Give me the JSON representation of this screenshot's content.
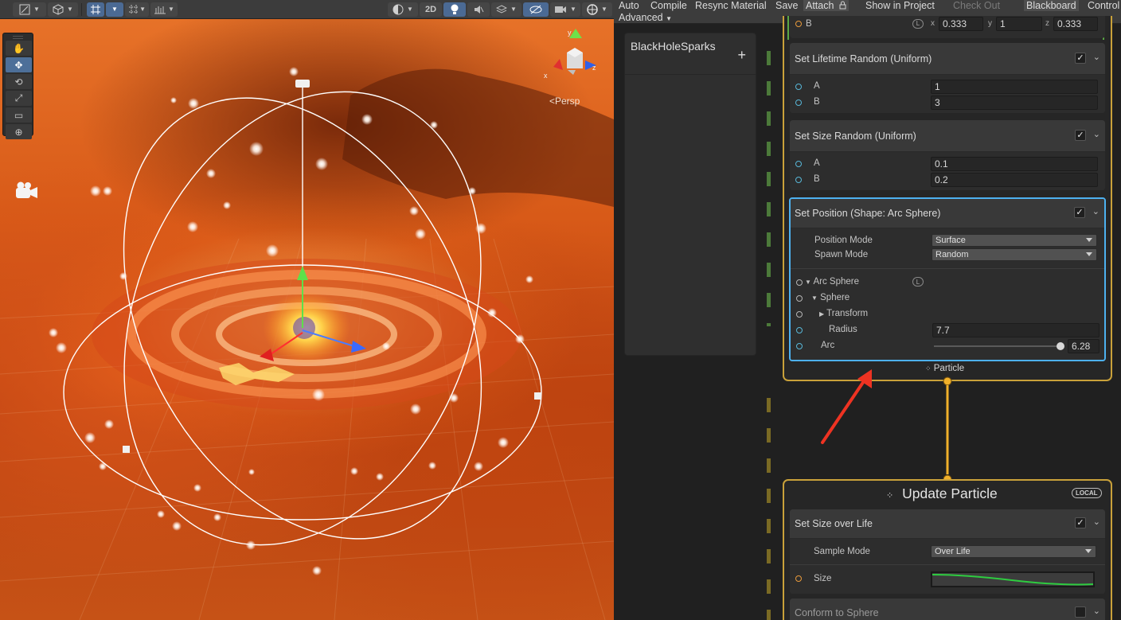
{
  "scene": {
    "toolbar": {
      "left_tools": [
        "draw-mode",
        "shading",
        "grid",
        "snap",
        "increment"
      ],
      "right_tools": [
        "render-mode",
        "2D",
        "lighting",
        "audio",
        "effects",
        "hidden",
        "camera",
        "gizmos"
      ],
      "two_d_label": "2D"
    },
    "tools": [
      "✋",
      "✥",
      "⟲",
      "⤢",
      "▭",
      "⊕"
    ],
    "gizmo": {
      "y_label": "y",
      "x_label": "x",
      "z_label": "z"
    },
    "persp_label": "<Persp"
  },
  "menubar": {
    "auto": "Auto",
    "compile": "Compile",
    "resync": "Resync Material",
    "save": "Save",
    "attach": "Attach",
    "show_in_project": "Show in Project",
    "check_out": "Check Out",
    "blackboard": "Blackboard",
    "control": "Control",
    "advanced": "Advanced"
  },
  "blackboard": {
    "title": "BlackHoleSparks",
    "add_symbol": "+"
  },
  "top_row": {
    "label": "B",
    "l_badge": "L",
    "x": "x",
    "x_val": "0.333",
    "y": "y",
    "y_val": "1",
    "z": "z",
    "z_val": "0.333"
  },
  "blocks": {
    "lifetime": {
      "title": "Set Lifetime Random (Uniform)",
      "a_label": "A",
      "a_value": "1",
      "b_label": "B",
      "b_value": "3"
    },
    "size": {
      "title": "Set Size Random (Uniform)",
      "a_label": "A",
      "a_value": "0.1",
      "b_label": "B",
      "b_value": "0.2"
    },
    "position": {
      "title": "Set Position (Shape: Arc Sphere)",
      "position_mode_label": "Position Mode",
      "position_mode": "Surface",
      "spawn_mode_label": "Spawn Mode",
      "spawn_mode": "Random",
      "arc_sphere_label": "Arc Sphere",
      "l_badge": "L",
      "sphere_label": "Sphere",
      "transform_label": "Transform",
      "radius_label": "Radius",
      "radius_value": "7.7",
      "arc_label": "Arc",
      "arc_value": "6.28",
      "arc_fraction": 1.0
    }
  },
  "particle_output": "Particle",
  "update": {
    "title": "Update Particle",
    "badge": "LOCAL",
    "size_over_life": {
      "title": "Set Size over Life",
      "sample_mode_label": "Sample Mode",
      "sample_mode": "Over Life",
      "size_label": "Size"
    },
    "conform": {
      "title": "Conform to Sphere"
    }
  },
  "colors": {
    "accent_selected": "#4db1f0",
    "context_border": "#c9a13a",
    "annotation_arrow": "#ee3322",
    "curve": "#2ecc40"
  }
}
